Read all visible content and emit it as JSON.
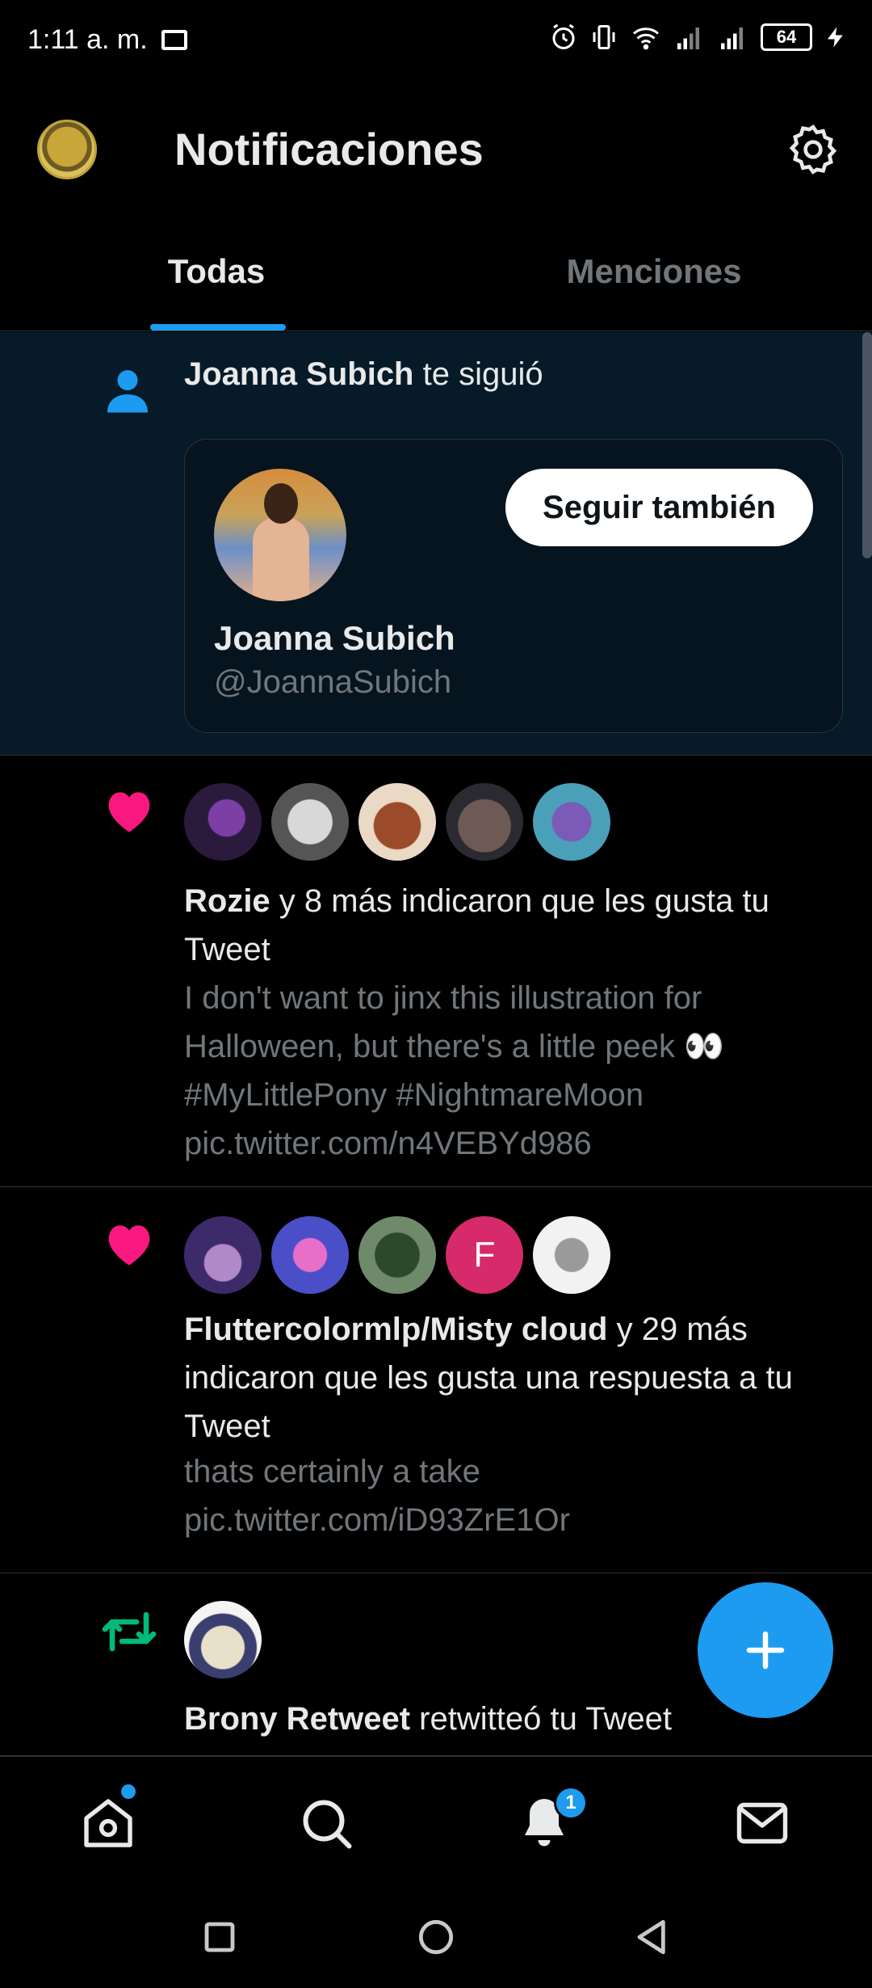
{
  "status_bar": {
    "time": "1:11 a. m.",
    "battery": "64"
  },
  "header": {
    "title": "Notificaciones",
    "avatar_icon": "profile-avatar-icon",
    "settings_icon": "gear-icon"
  },
  "tabs": [
    {
      "label": "Todas",
      "active": true
    },
    {
      "label": "Menciones",
      "active": false
    }
  ],
  "notifications": {
    "follow": {
      "user": "Joanna Subich",
      "action": " te siguió",
      "card": {
        "name": "Joanna Subich",
        "handle": "@JoannaSubich",
        "button": "Seguir también"
      }
    },
    "like1": {
      "user": "Rozie",
      "action": " y 8 más indicaron que les gusta tu Tweet",
      "tweet": "I don't want to jinx this illustration for Halloween, but there's a little peek 👀 #MyLittlePony #NightmareMoon pic.twitter.com/n4VEBYd986"
    },
    "like2": {
      "user": "Fluttercolormlp/Misty cloud",
      "action": " y 29 más indicaron que les gusta una respuesta a tu Tweet",
      "tweet": "thats certainly a take pic.twitter.com/iD93ZrE1Or",
      "letter_avatar": "F"
    },
    "retweet": {
      "user": "Brony Retweet",
      "action": " retwitteó tu Tweet"
    }
  },
  "bottom_nav": {
    "notification_badge": "1"
  },
  "colors": {
    "accent": "#1d9bf0",
    "like": "#f91880",
    "retweet": "#00ba7c",
    "background": "#000000"
  }
}
